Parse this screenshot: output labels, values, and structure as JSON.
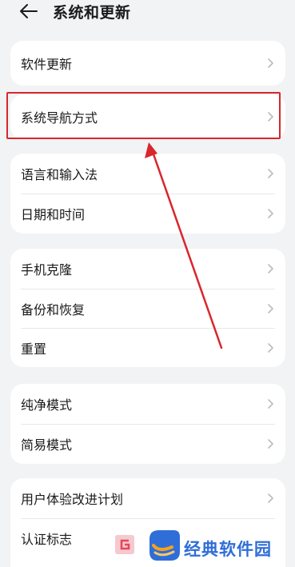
{
  "header": {
    "title": "系统和更新",
    "back_icon": "back-arrow-icon"
  },
  "groups": [
    {
      "items": [
        {
          "label": "软件更新"
        }
      ]
    },
    {
      "items": [
        {
          "label": "系统导航方式"
        }
      ]
    },
    {
      "items": [
        {
          "label": "语言和输入法"
        },
        {
          "label": "日期和时间"
        }
      ]
    },
    {
      "items": [
        {
          "label": "手机克隆"
        },
        {
          "label": "备份和恢复"
        },
        {
          "label": "重置"
        }
      ]
    },
    {
      "items": [
        {
          "label": "纯净模式"
        },
        {
          "label": "简易模式"
        }
      ]
    },
    {
      "items": [
        {
          "label": "用户体验改进计划"
        },
        {
          "label": "认证标志"
        }
      ]
    }
  ],
  "annotation": {
    "color": "#d9262c"
  },
  "watermark": {
    "text": "经典软件园",
    "color": "#2f6ed8"
  },
  "colors": {
    "background": "#f1f3f5",
    "card": "#ffffff",
    "chevron": "#b8bcc2"
  }
}
